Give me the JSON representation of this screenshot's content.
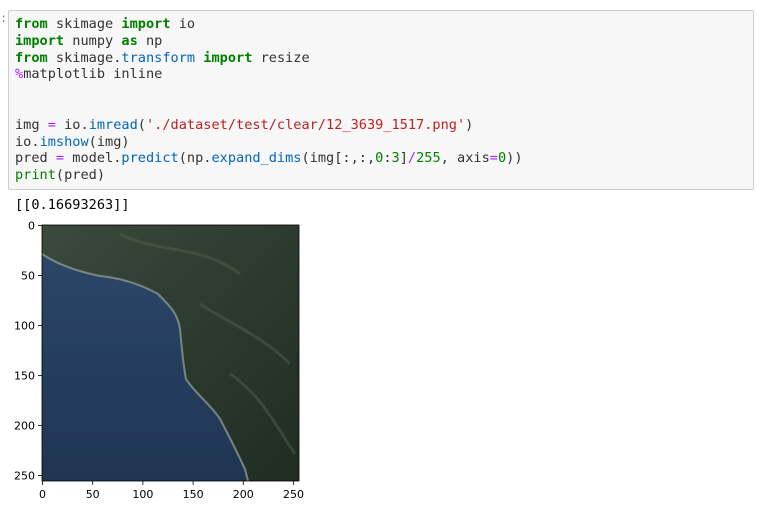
{
  "cell": {
    "lines": [
      [
        {
          "t": "from",
          "c": "kw"
        },
        {
          "t": " skimage ",
          "c": ""
        },
        {
          "t": "import",
          "c": "kw"
        },
        {
          "t": " io",
          "c": ""
        }
      ],
      [
        {
          "t": "import",
          "c": "kw"
        },
        {
          "t": " numpy ",
          "c": ""
        },
        {
          "t": "as",
          "c": "kw"
        },
        {
          "t": " np",
          "c": ""
        }
      ],
      [
        {
          "t": "from",
          "c": "kw"
        },
        {
          "t": " skimage.",
          "c": ""
        },
        {
          "t": "transform",
          "c": "fn"
        },
        {
          "t": " ",
          "c": ""
        },
        {
          "t": "import",
          "c": "kw"
        },
        {
          "t": " resize",
          "c": ""
        }
      ],
      [
        {
          "t": "%",
          "c": "op"
        },
        {
          "t": "matplotlib inline",
          "c": ""
        }
      ],
      [],
      [],
      [
        {
          "t": "img ",
          "c": ""
        },
        {
          "t": "=",
          "c": "op"
        },
        {
          "t": " io.",
          "c": ""
        },
        {
          "t": "imread",
          "c": "fn"
        },
        {
          "t": "(",
          "c": ""
        },
        {
          "t": "'./dataset/test/clear/12_3639_1517.png'",
          "c": "str"
        },
        {
          "t": ")",
          "c": ""
        }
      ],
      [
        {
          "t": "io.",
          "c": ""
        },
        {
          "t": "imshow",
          "c": "fn"
        },
        {
          "t": "(img)",
          "c": ""
        }
      ],
      [
        {
          "t": "pred ",
          "c": ""
        },
        {
          "t": "=",
          "c": "op"
        },
        {
          "t": " model.",
          "c": ""
        },
        {
          "t": "predict",
          "c": "fn"
        },
        {
          "t": "(np.",
          "c": ""
        },
        {
          "t": "expand_dims",
          "c": "fn"
        },
        {
          "t": "(img[:,:,",
          "c": ""
        },
        {
          "t": "0",
          "c": "num"
        },
        {
          "t": ":",
          "c": ""
        },
        {
          "t": "3",
          "c": "num"
        },
        {
          "t": "]",
          "c": ""
        },
        {
          "t": "/",
          "c": "op"
        },
        {
          "t": "255",
          "c": "num"
        },
        {
          "t": ", axis",
          "c": ""
        },
        {
          "t": "=",
          "c": "op"
        },
        {
          "t": "0",
          "c": "num"
        },
        {
          "t": "))",
          "c": ""
        }
      ],
      [
        {
          "t": "print",
          "c": "bi"
        },
        {
          "t": "(pred)",
          "c": ""
        }
      ]
    ]
  },
  "output": {
    "text": "[[0.16693263]]"
  },
  "chart_data": {
    "type": "image",
    "x_ticks": [
      "0",
      "50",
      "100",
      "150",
      "200",
      "250"
    ],
    "y_ticks": [
      "0",
      "50",
      "100",
      "150",
      "200",
      "250"
    ],
    "x_tick_values": [
      0,
      50,
      100,
      150,
      200,
      250
    ],
    "y_tick_values": [
      0,
      50,
      100,
      150,
      200,
      250
    ],
    "xlim": [
      -0.5,
      255.5
    ],
    "ylim": [
      255.5,
      -0.5
    ],
    "image_description_colors": {
      "land": "#2c3d2e",
      "sea": "#223a5a",
      "coast": "#8a9a94"
    }
  }
}
